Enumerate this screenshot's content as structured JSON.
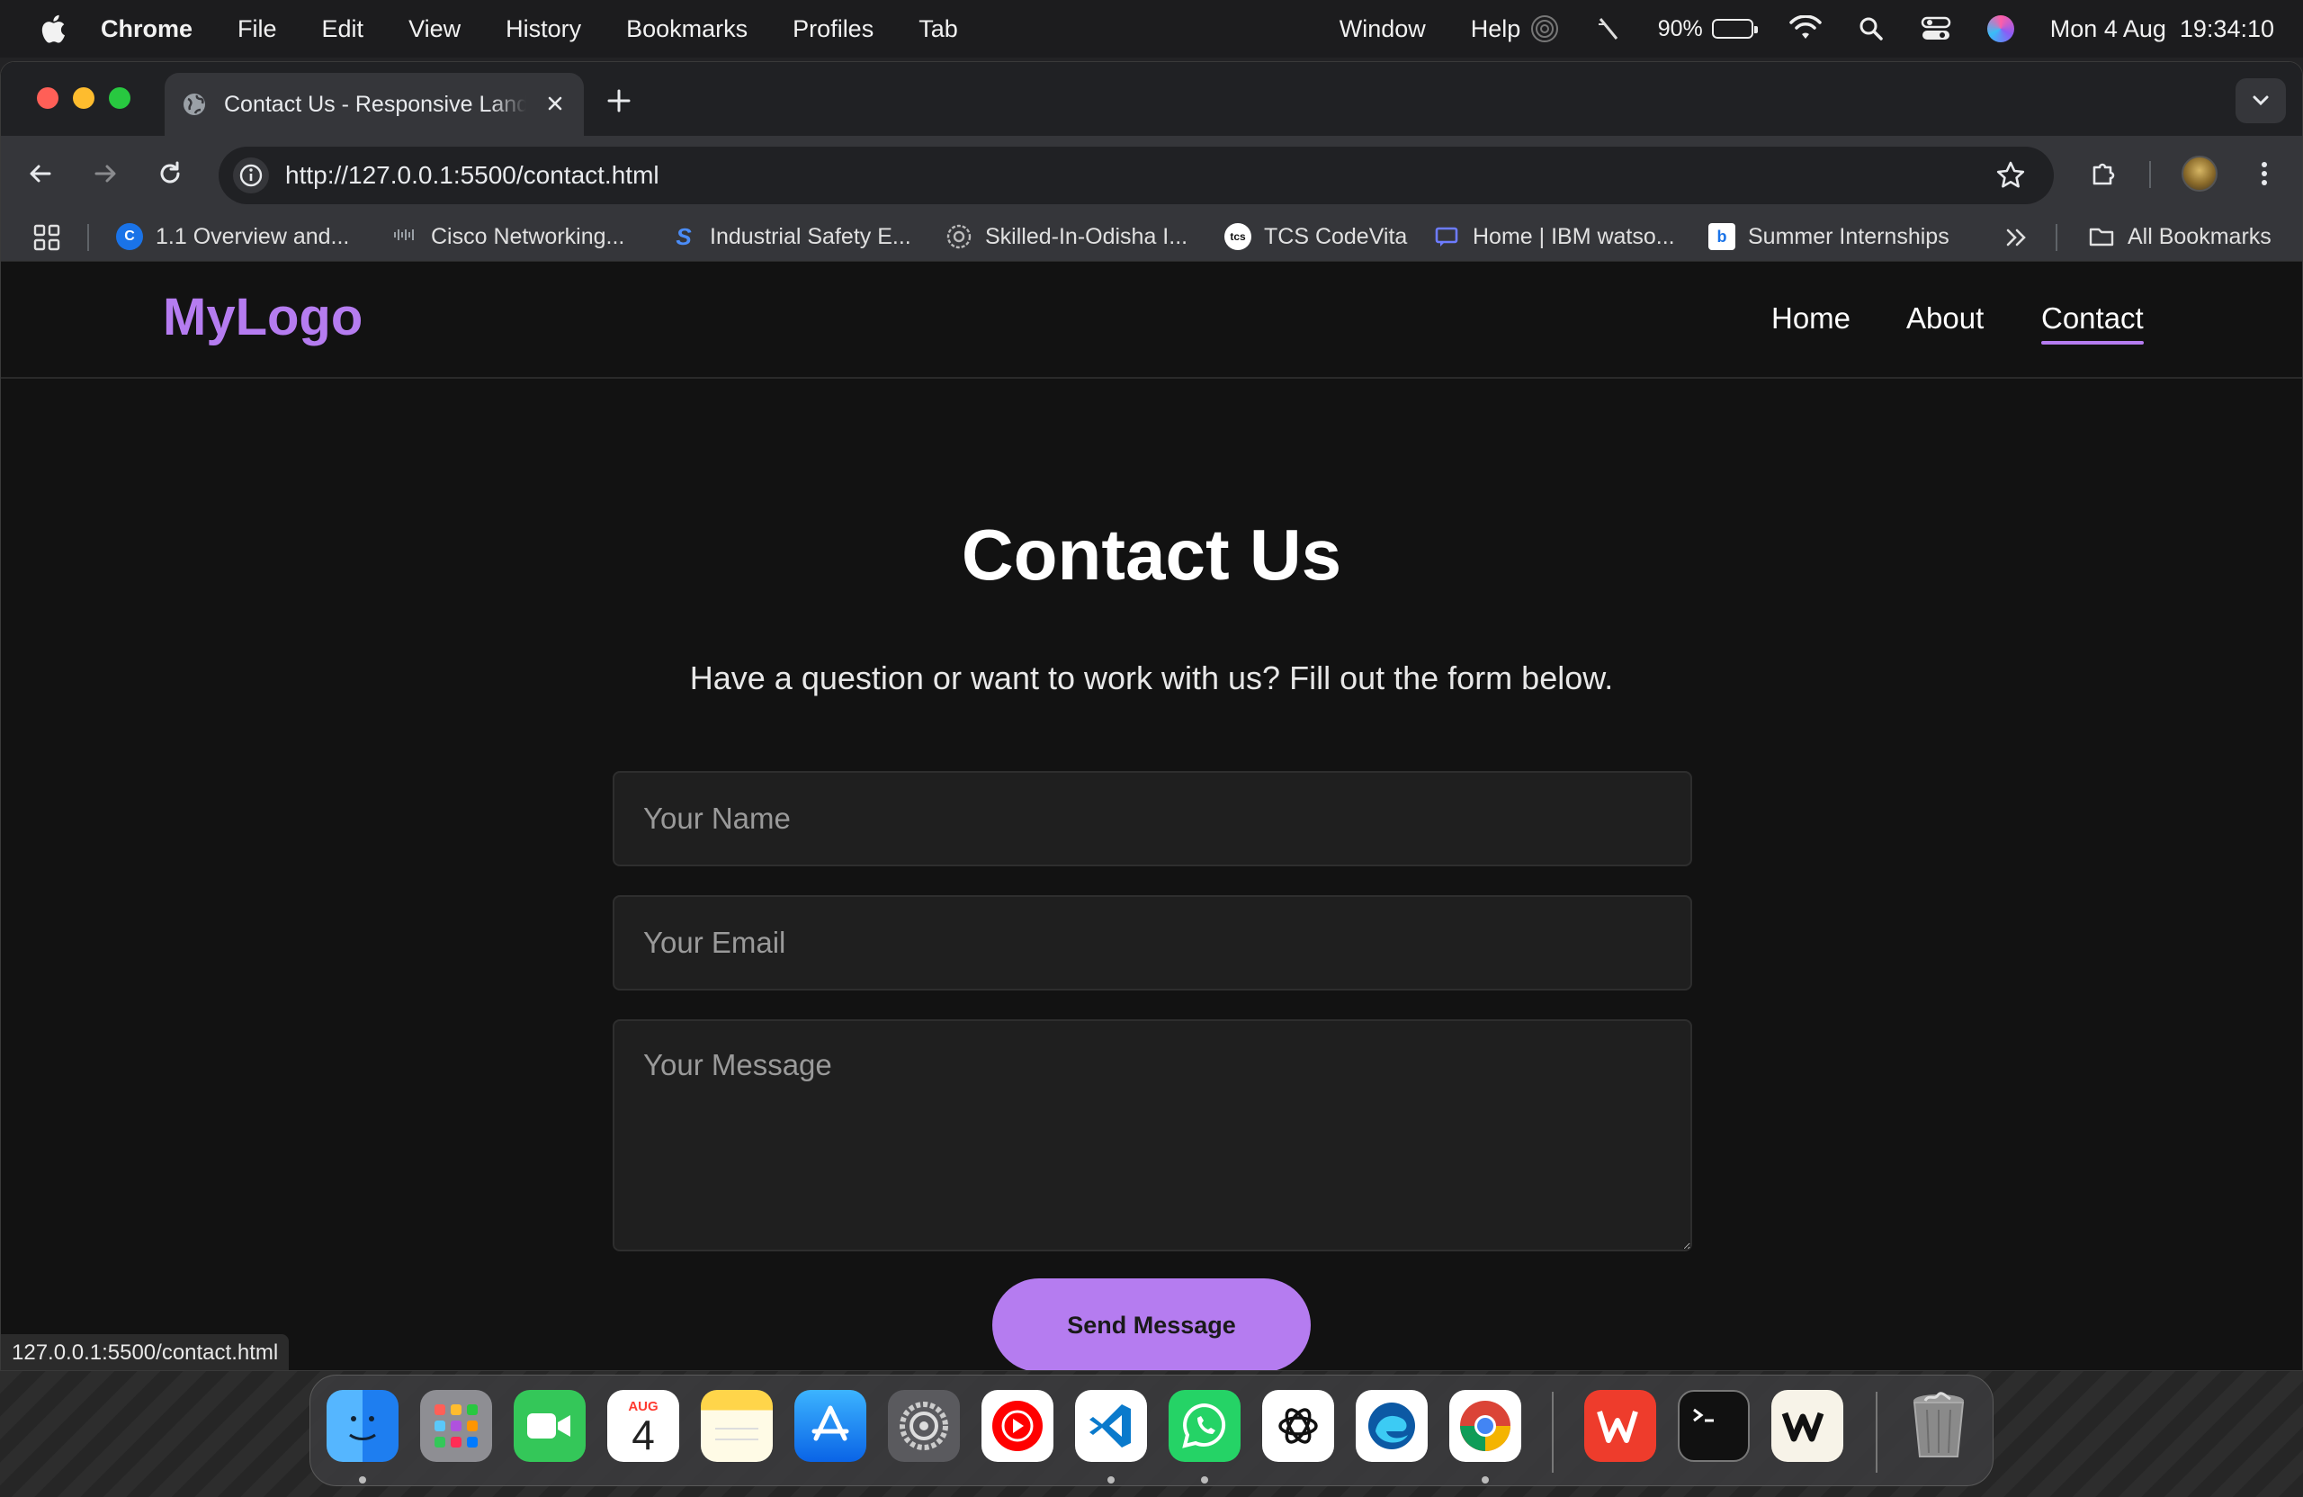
{
  "menubar": {
    "app": "Chrome",
    "menus": [
      "File",
      "Edit",
      "View",
      "History",
      "Bookmarks",
      "Profiles",
      "Tab",
      "Window",
      "Help"
    ],
    "battery_percent": "90%",
    "battery_level": 0.9,
    "datetime": "Mon 4 Aug  19:34:10"
  },
  "browser": {
    "tab_title": "Contact Us - Responsive Landing",
    "url": "http://127.0.0.1:5500/contact.html",
    "bookmarks": [
      {
        "label": "1.1 Overview and...",
        "icon": "c-badge-icon"
      },
      {
        "label": "Cisco Networking...",
        "icon": "cisco-icon"
      },
      {
        "label": "Industrial Safety E...",
        "icon": "s-badge-icon"
      },
      {
        "label": "Skilled-In-Odisha I...",
        "icon": "gear-badge-icon"
      },
      {
        "label": "TCS CodeVita",
        "icon": "tcs-icon"
      },
      {
        "label": "Home | IBM watso...",
        "icon": "ibm-icon"
      },
      {
        "label": "Summer Internships",
        "icon": "internshala-icon"
      }
    ],
    "all_bookmarks": "All Bookmarks",
    "status_url": "127.0.0.1:5500/contact.html"
  },
  "site": {
    "logo": "MyLogo",
    "nav": [
      "Home",
      "About",
      "Contact"
    ],
    "active_nav": "Contact",
    "accent": "#b57cf0",
    "heading": "Contact Us",
    "subtext": "Have a question or want to work with us? Fill out the form below.",
    "form": {
      "name_placeholder": "Your Name",
      "email_placeholder": "Your Email",
      "message_placeholder": "Your Message",
      "submit": "Send Message"
    }
  },
  "dock": {
    "calendar_month": "AUG",
    "calendar_day": "4",
    "apps": [
      "Finder",
      "Launchpad",
      "FaceTime",
      "Calendar",
      "Notes",
      "App Store",
      "System Settings",
      "YouTube Music",
      "Visual Studio Code",
      "WhatsApp",
      "ChatGPT",
      "Microsoft Edge",
      "Google Chrome",
      "WPS Office",
      "Terminal",
      "Warp",
      "Trash"
    ]
  }
}
